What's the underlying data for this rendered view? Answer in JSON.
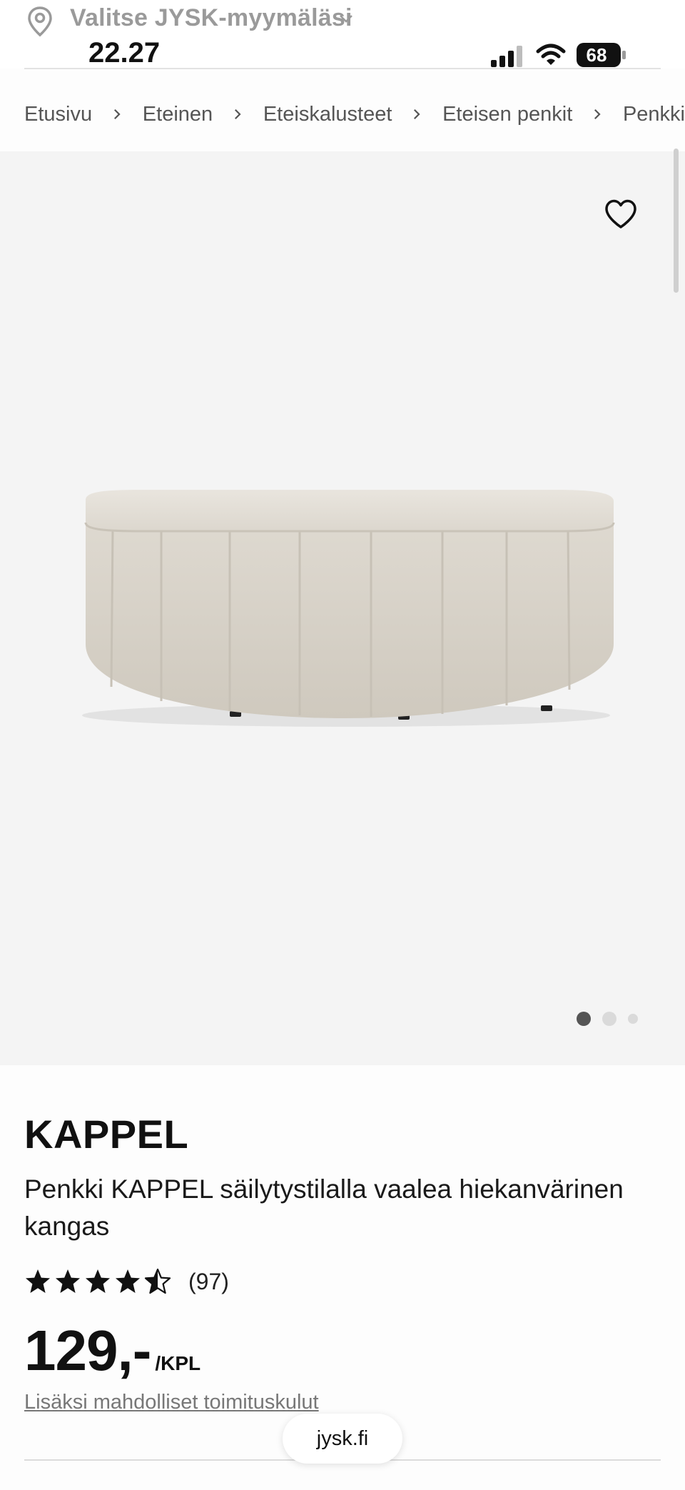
{
  "store_bar": {
    "label": "Valitse JYSK-myymälä́si",
    "label_plain": "Valitse JYSK-myymäläsi"
  },
  "status_bar": {
    "time": "22.27",
    "battery": "68"
  },
  "breadcrumb": [
    "Etusivu",
    "Eteinen",
    "Eteiskalusteet",
    "Eteisen penkit",
    "Penkki"
  ],
  "gallery": {
    "image_count": 3,
    "active_index": 0
  },
  "product": {
    "brand": "KAPPEL",
    "description": "Penkki KAPPEL säilytystilalla vaalea hiekanvärinen kangas",
    "rating_stars": 4.5,
    "review_count": "(97)",
    "price": "129,-",
    "price_unit": "/KPL",
    "shipping_note": "Lisäksi mahdolliset toimituskulut"
  },
  "browser": {
    "url": "jysk.fi"
  },
  "colors": {
    "hero_bg": "#f4f4f4",
    "fabric": "#e3ded6",
    "text": "#111111",
    "muted": "#777777"
  }
}
